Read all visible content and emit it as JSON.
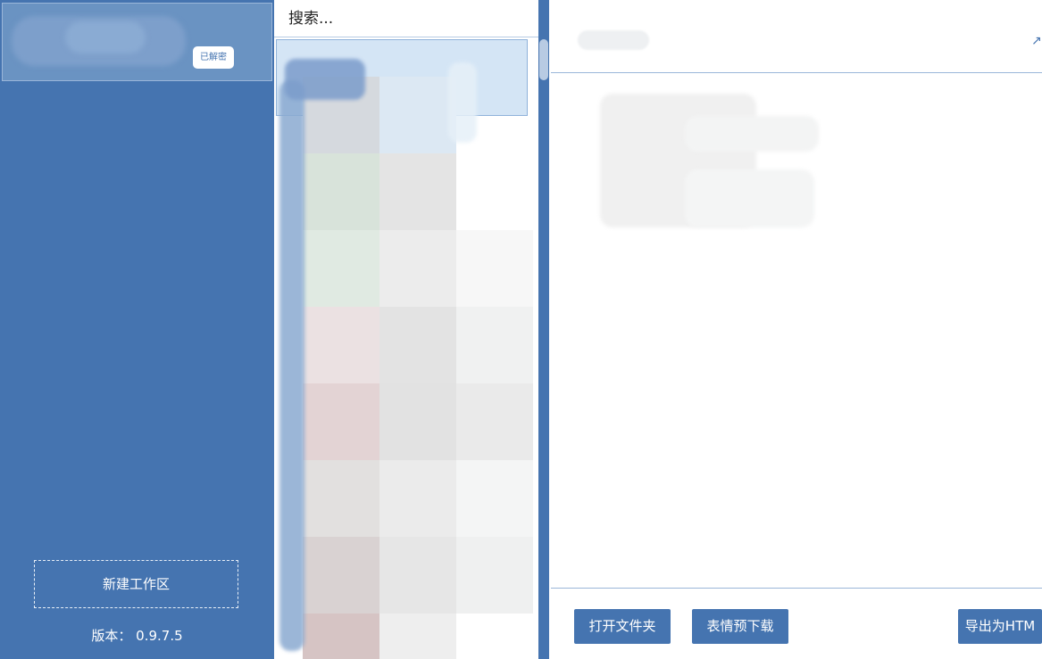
{
  "sidebar": {
    "account_badge": "已解密",
    "new_workspace_label": "新建工作区",
    "version_label": "版本：",
    "version_value": "0.9.7.5",
    "accent_color": "#4574b0"
  },
  "list": {
    "search_placeholder": "搜索..."
  },
  "content": {
    "open_in_icon": "external-link-icon",
    "buttons": {
      "open_folder": "打开文件夹",
      "sticker_download": "表情预下载",
      "export_html": "导出为HTM"
    }
  }
}
